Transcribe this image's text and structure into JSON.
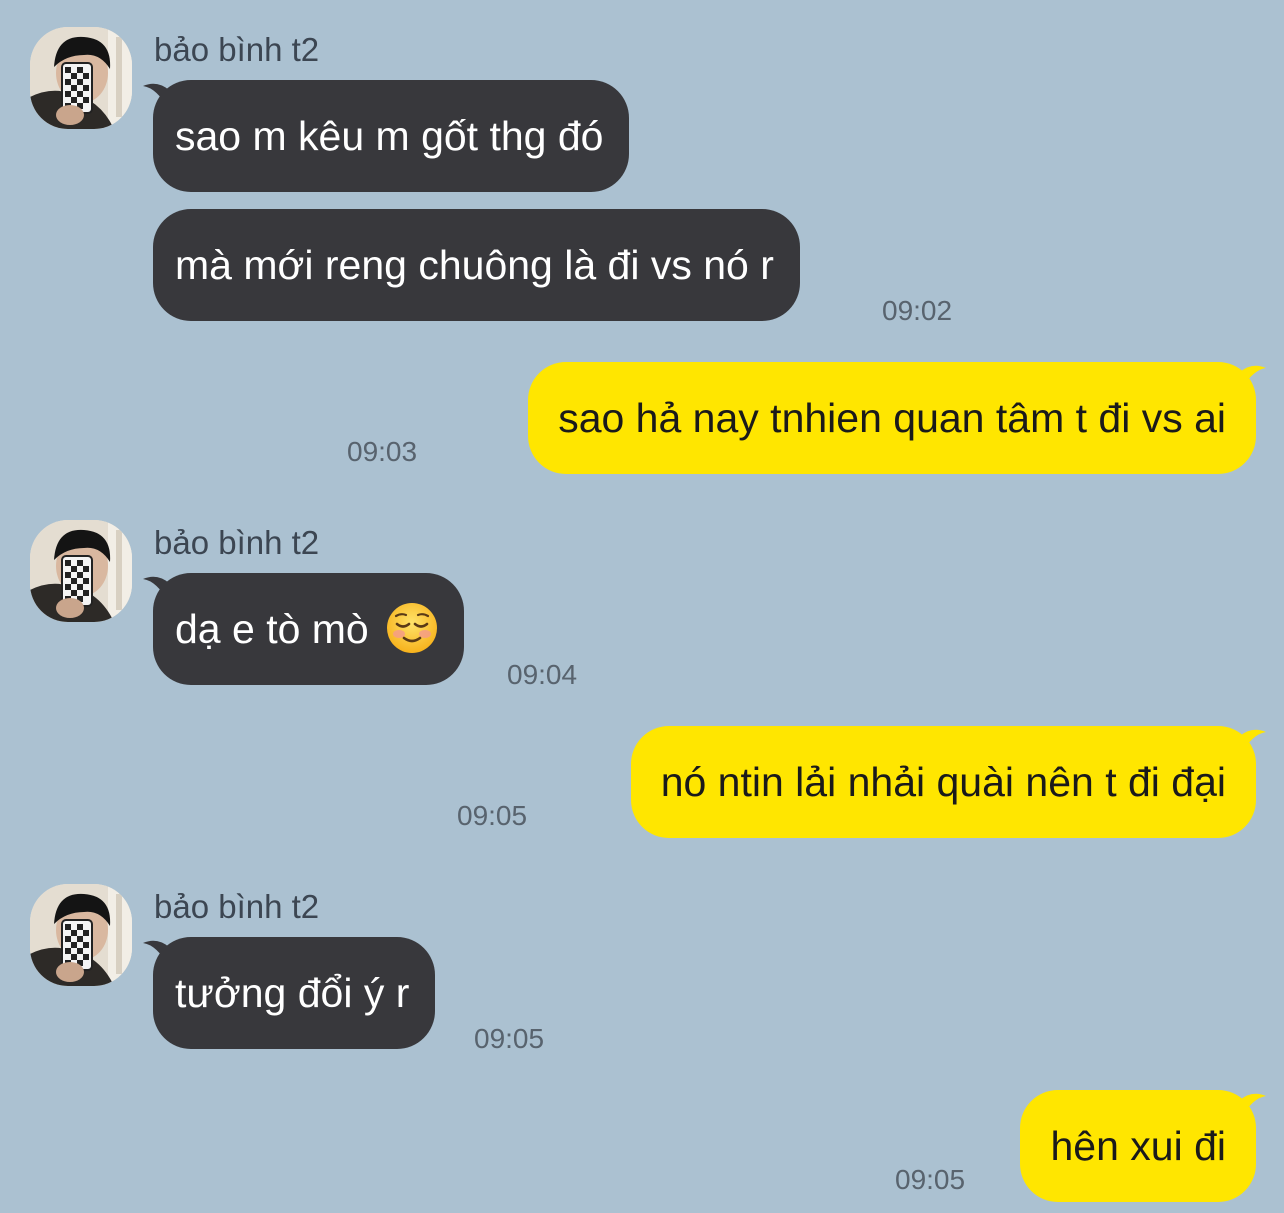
{
  "chat": {
    "contact_name": "bảo bình t2",
    "messages": [
      {
        "direction": "in",
        "text": "sao m kêu m gốt thg đó"
      },
      {
        "direction": "in",
        "text": "mà mới reng chuông là đi vs nó r",
        "time": "09:02"
      },
      {
        "direction": "out",
        "text": "sao hả nay tnhien quan tâm t đi vs ai",
        "time": "09:03"
      },
      {
        "direction": "in",
        "text": "dạ e tò mò",
        "emoji": "smiling-face-emoji",
        "time": "09:04"
      },
      {
        "direction": "out",
        "text": "nó ntin lải nhải quài nên t đi đại",
        "time": "09:05"
      },
      {
        "direction": "in",
        "text": "tưởng đổi ý r",
        "time": "09:05"
      },
      {
        "direction": "out",
        "text": "hên xui đi",
        "time": "09:05"
      }
    ]
  },
  "colors": {
    "background": "#abc1d1",
    "incoming_bubble": "#38383c",
    "outgoing_bubble": "#ffe600",
    "timestamp": "#58636e"
  }
}
